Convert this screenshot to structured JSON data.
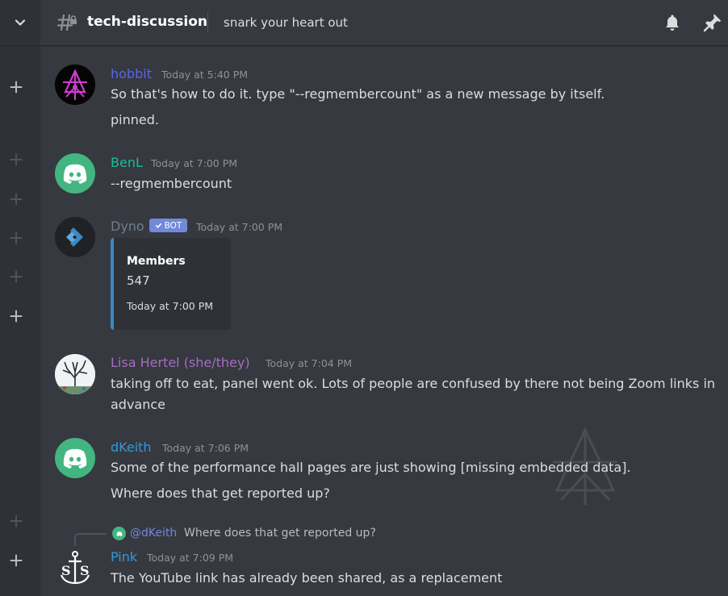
{
  "header": {
    "channel_name": "tech-discussion",
    "topic": "snark your heart out"
  },
  "icons": {
    "collapse": "chevron-down-icon",
    "channel": "hash-lock-icon",
    "notifications": "bell-icon",
    "pins": "pin-icon",
    "rail_add": "plus-icon"
  },
  "colors": {
    "hobbit": "#5865f2",
    "benl": "#1abc9c",
    "dyno": "#6f7e8c",
    "lisa": "#a56bc4",
    "dkeith": "#3498db",
    "pink": "#3498db",
    "bot_badge": "#7289da",
    "embed_accent": "#3b88c3",
    "discord_green": "#43b581"
  },
  "messages": [
    {
      "author": "hobbit",
      "timestamp": "Today at 5:40 PM",
      "lines": [
        "So that's how to do it.  type \"--regmembercount\" as a new message by itself.",
        "pinned."
      ]
    },
    {
      "author": "BenL",
      "timestamp": "Today at 7:00 PM",
      "lines": [
        "--regmembercount"
      ]
    },
    {
      "author": "Dyno",
      "badge": "BOT",
      "timestamp": "Today at 7:00 PM",
      "embed": {
        "title": "Members",
        "value": "547",
        "footer": "Today at 7:00 PM"
      }
    },
    {
      "author": "Lisa Hertel (she/they)",
      "timestamp": "Today at 7:04 PM",
      "lines": [
        "taking off to eat, panel went ok. Lots of people are confused by there not being Zoom links in",
        "advance"
      ]
    },
    {
      "author": "dKeith",
      "timestamp": "Today at 7:06 PM",
      "lines": [
        "Some of the performance hall pages are just showing [missing embedded data].",
        "Where does that get reported up?"
      ]
    },
    {
      "author": "Pink",
      "timestamp": "Today at 7:09 PM",
      "reply": {
        "mention": "@dKeith",
        "text": "Where does that get reported up?"
      },
      "lines": [
        "The YouTube link has already been shared, as a replacement"
      ]
    }
  ]
}
